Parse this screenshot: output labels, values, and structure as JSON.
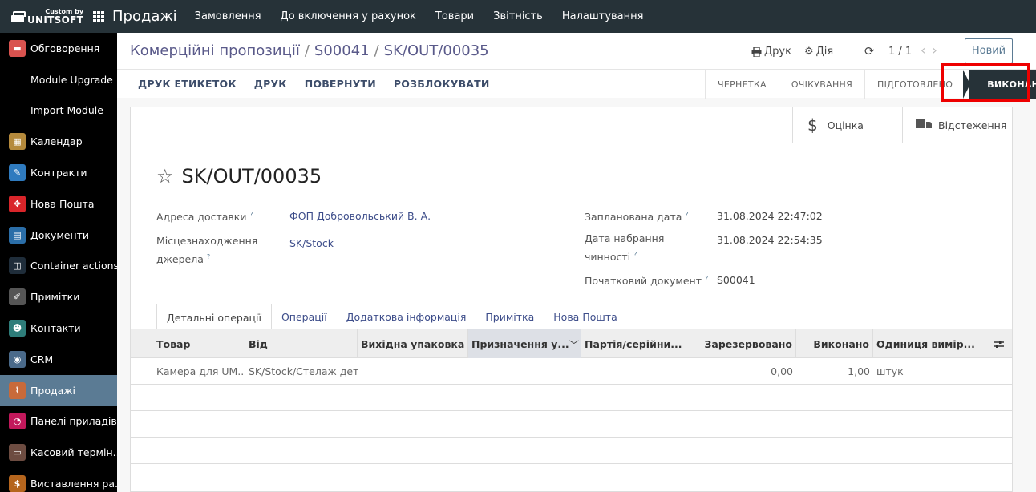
{
  "brand": {
    "top": "Custom by",
    "bottom": "UNITSOFT"
  },
  "app_title": "Продажі",
  "top_menu": [
    "Замовлення",
    "До включення у рахунок",
    "Товари",
    "Звітність",
    "Налаштування"
  ],
  "sidebar": {
    "items": [
      {
        "label": "Обговорення",
        "icon": "chat-icon",
        "color": "#d9534f"
      },
      {
        "label": "Module Upgrade",
        "icon": "",
        "color": ""
      },
      {
        "label": "Import Module",
        "icon": "",
        "color": ""
      },
      {
        "label": "Календар",
        "icon": "calendar-icon",
        "color": "#b58a3c"
      },
      {
        "label": "Контракти",
        "icon": "contract-icon",
        "color": "#2f7bbf"
      },
      {
        "label": "Нова Пошта",
        "icon": "nova-poshta-icon",
        "color": "#d9252a"
      },
      {
        "label": "Документи",
        "icon": "documents-icon",
        "color": "#2b6ea8"
      },
      {
        "label": "Container actions",
        "icon": "container-icon",
        "color": "#1f2d3a"
      },
      {
        "label": "Примітки",
        "icon": "notes-icon",
        "color": "#555555"
      },
      {
        "label": "Контакти",
        "icon": "contacts-icon",
        "color": "#2e7d7a"
      },
      {
        "label": "CRM",
        "icon": "crm-icon",
        "color": "#4a6a8a"
      },
      {
        "label": "Продажі",
        "icon": "sales-icon",
        "color": "#c86a3a"
      },
      {
        "label": "Панелі приладів",
        "icon": "dashboard-icon",
        "color": "#c2185b"
      },
      {
        "label": "Касовий термін...",
        "icon": "pos-icon",
        "color": "#6d4c41"
      },
      {
        "label": "Виставлення ра...",
        "icon": "invoice-icon",
        "color": "#b5651d"
      }
    ],
    "active_index": 11
  },
  "breadcrumb": [
    "Комерційні пропозиції",
    "S00041",
    "SK/OUT/00035"
  ],
  "cp": {
    "print": "Друк",
    "action": "Дія",
    "pager": "1 / 1",
    "new_button": "Новий"
  },
  "action_buttons": [
    "ДРУК ЕТИКЕТОК",
    "ДРУК",
    "ПОВЕРНУТИ",
    "РОЗБЛОКУВАТИ"
  ],
  "stages": [
    "ЧЕРНЕТКА",
    "ОЧІКУВАННЯ",
    "ПІДГОТОВЛЕНО",
    "ВИКОНАНО"
  ],
  "current_stage": "ВИКОНАНО",
  "smart_buttons": {
    "valuation": "Оцінка",
    "traceability": "Відстеження"
  },
  "record": {
    "title": "SK/OUT/00035",
    "fields_left": [
      {
        "label": "Адреса доставки",
        "value": "ФОП Добровольський В. А."
      },
      {
        "label": "Місцезнаходження джерела",
        "value": "SK/Stock"
      }
    ],
    "fields_right": [
      {
        "label": "Запланована дата",
        "value": "31.08.2024 22:47:02"
      },
      {
        "label": "Дата набрання чинності",
        "value": "31.08.2024 22:54:35"
      },
      {
        "label": "Початковий документ",
        "value": "S00041"
      }
    ]
  },
  "tabs": [
    "Детальні операції",
    "Операції",
    "Додаткова інформація",
    "Примітка",
    "Нова Пошта"
  ],
  "table": {
    "columns": [
      "Товар",
      "Від",
      "Вихідна упаковка",
      "Призначення у...",
      "Партія/серійни...",
      "Зарезервовано",
      "Виконано",
      "Одиниця вимір..."
    ],
    "rows": [
      [
        "Камера для UM...",
        "SK/Stock/Стелаж дет...",
        "",
        "",
        "",
        "0,00",
        "1,00",
        "штук"
      ]
    ]
  }
}
